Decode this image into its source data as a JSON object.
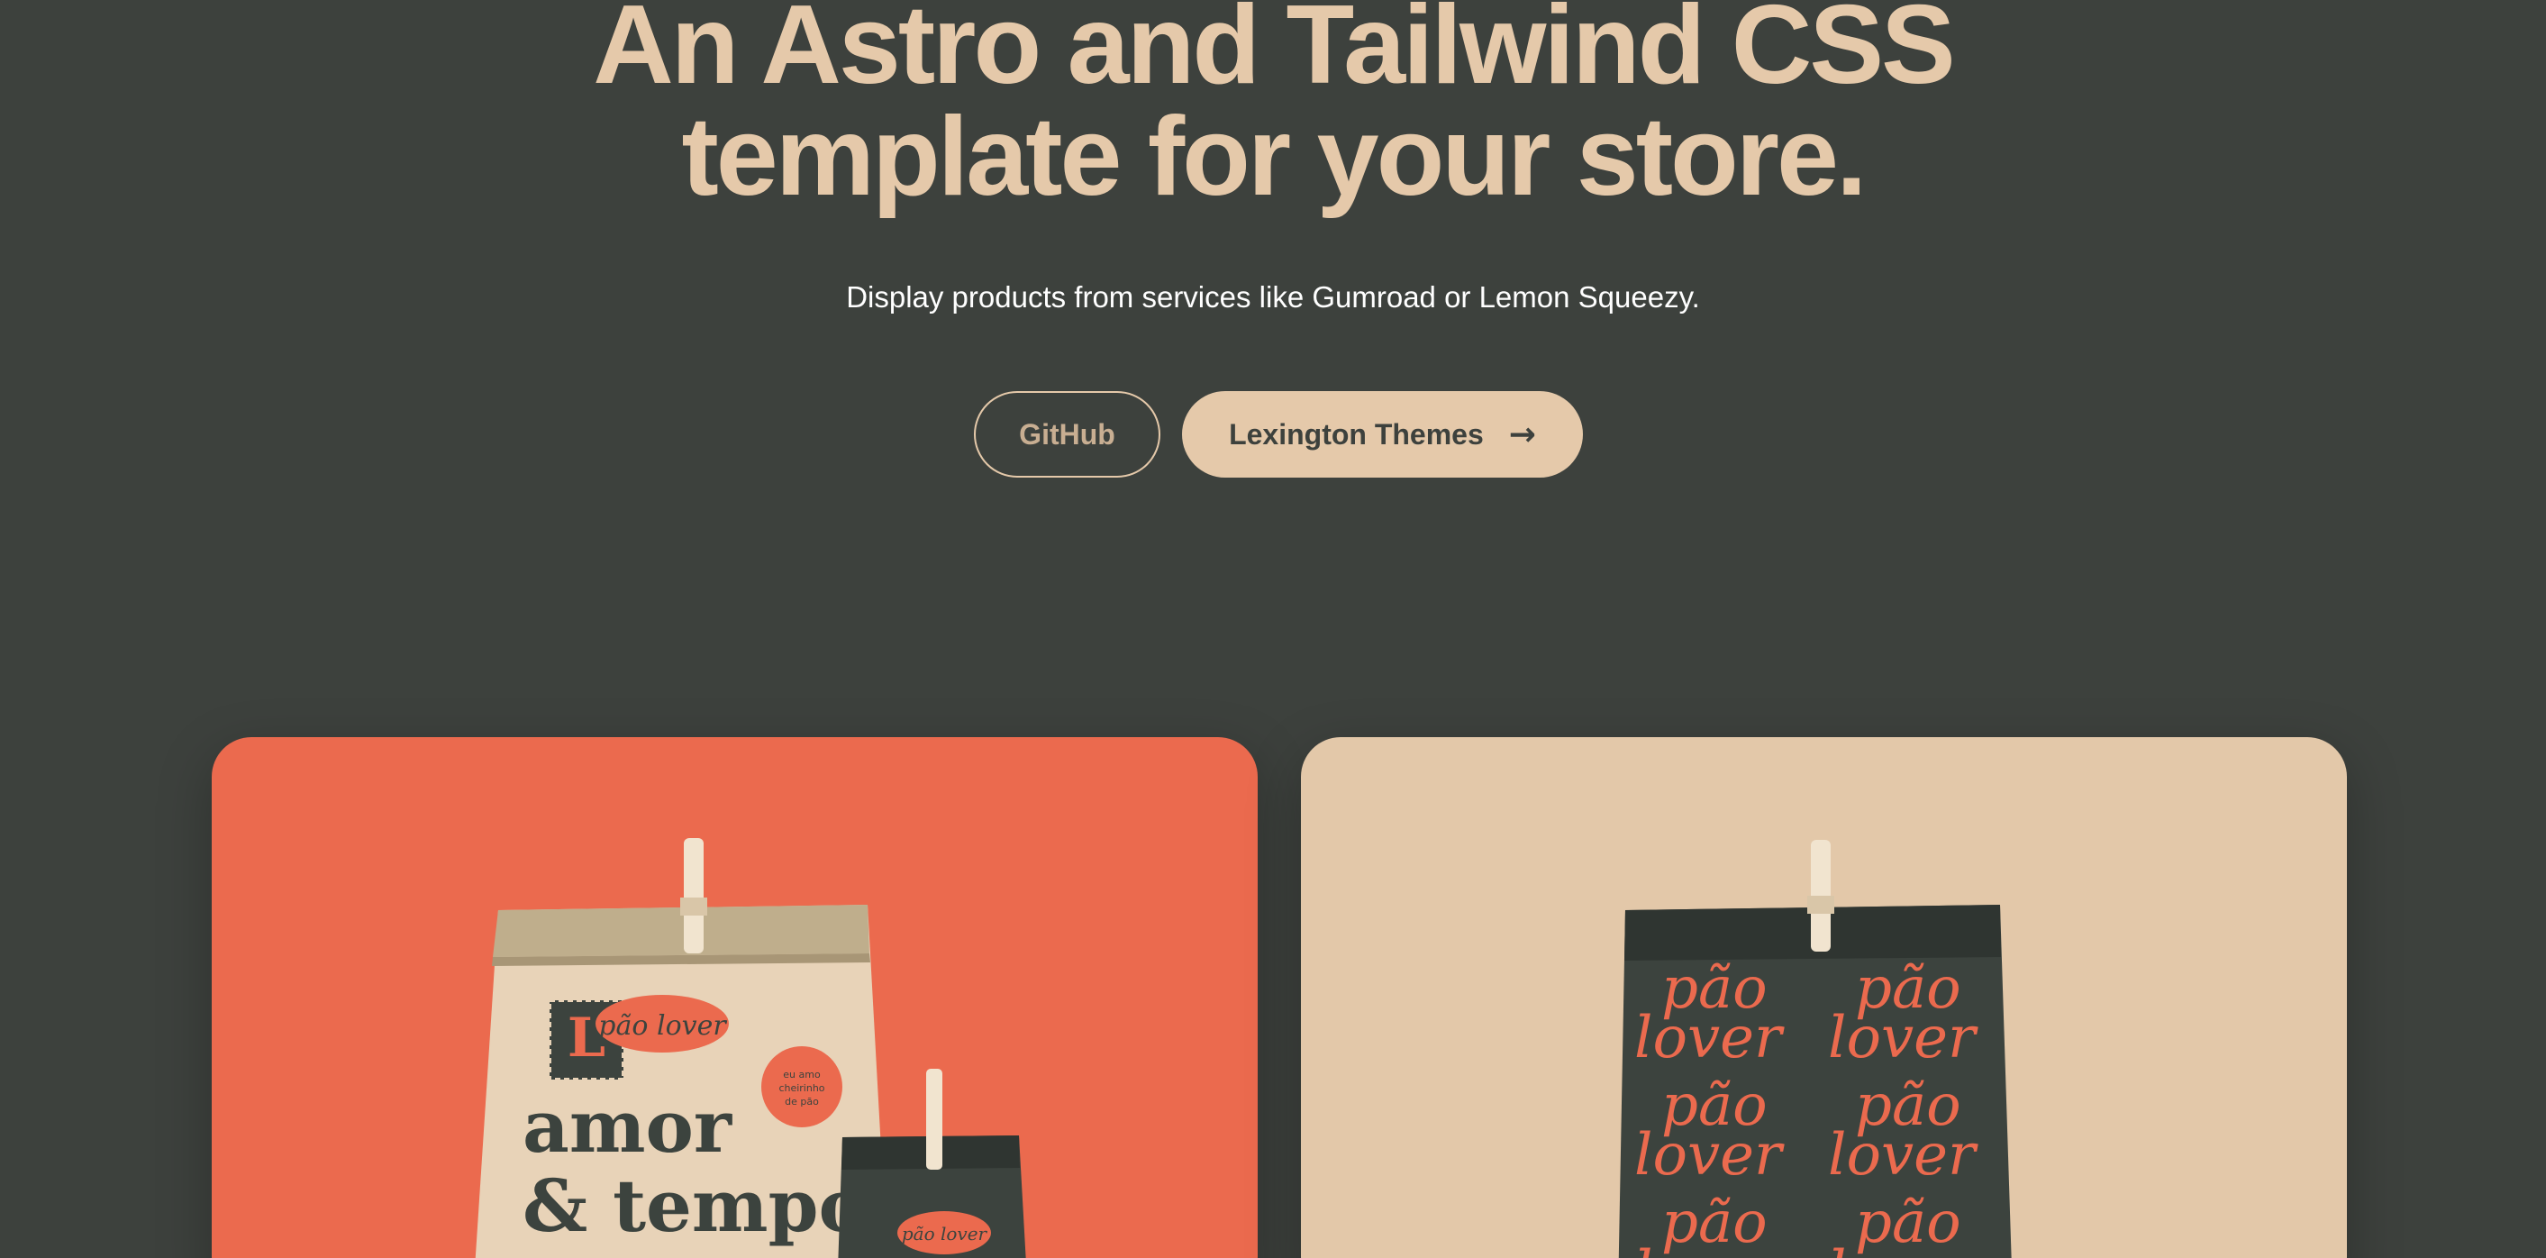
{
  "hero": {
    "title_line1": "An Astro and Tailwind CSS",
    "title_line2": "template for your store.",
    "subtitle": "Display products from services like Gumroad or Lemon Squeezy."
  },
  "buttons": {
    "github_label": "GitHub",
    "lexington_label": "Lexington Themes",
    "lexington_icon": "arrow-right-icon"
  },
  "products": [
    {
      "background": "#eb6a4e",
      "image": "kraft-paper-bag-image",
      "brand_logo": "pão lover",
      "sticker": "eu amo cheirinho de pão",
      "headline_line1": "amor",
      "headline_line2": "& tempo",
      "small_bag_logo": "pão lover"
    },
    {
      "background": "#e3c8a9",
      "image": "patterned-dark-bag-image",
      "pattern_text_line1": "pão",
      "pattern_text_line2": "lover"
    }
  ],
  "colors": {
    "page_background": "#3d413d",
    "accent": "#e5c9aa",
    "coral": "#eb6a4e",
    "dark_green": "#3c433e"
  }
}
